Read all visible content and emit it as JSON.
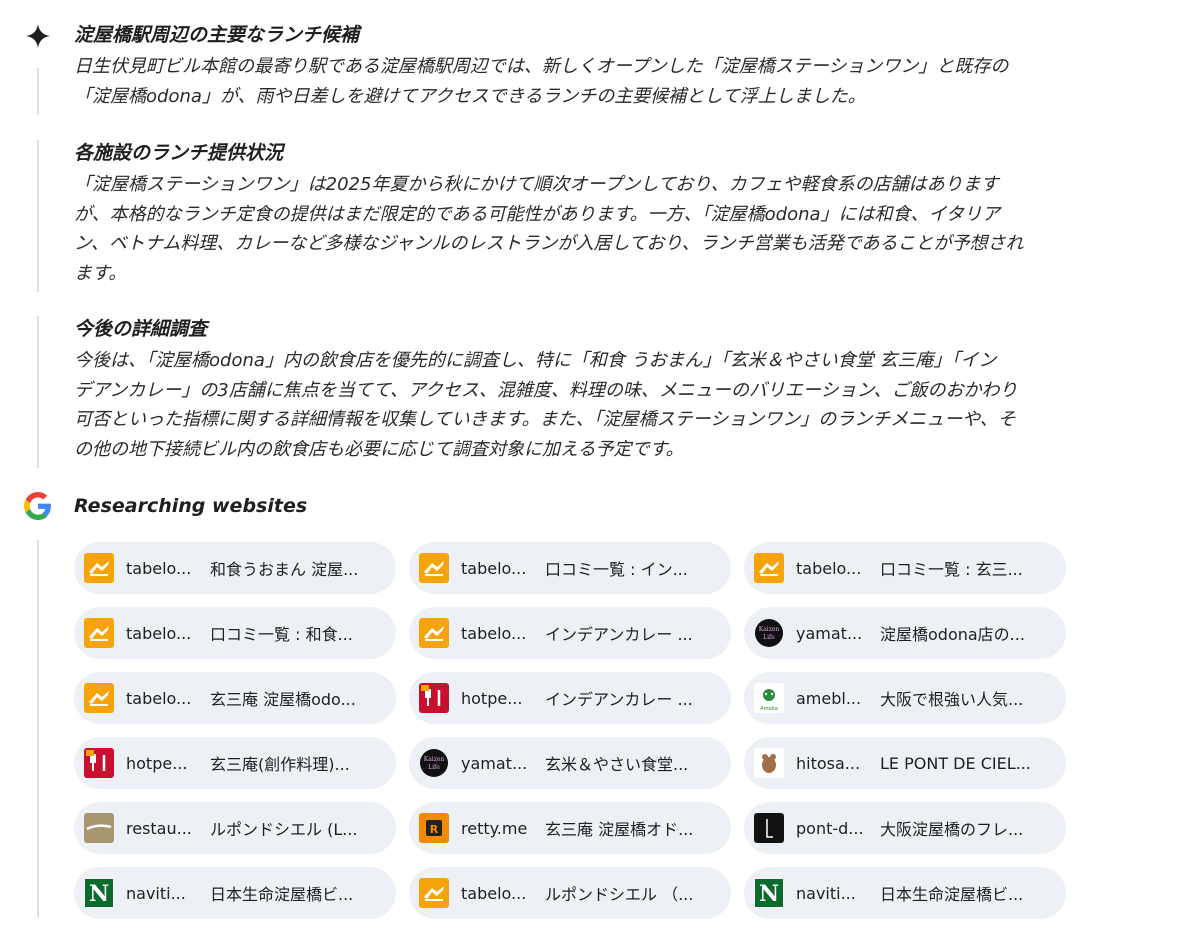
{
  "sections": [
    {
      "heading": "淀屋橋駅周辺の主要なランチ候補",
      "lines": [
        "日生伏見町ビル本館の最寄り駅である淀屋橋駅周辺では、新しくオープンした「淀屋橋ステーションワン」と既存の",
        "「淀屋橋odona」が、雨や日差しを避けてアクセスできるランチの主要候補として浮上しました。"
      ]
    },
    {
      "heading": "各施設のランチ提供状況",
      "lines": [
        "「淀屋橋ステーションワン」は2025年夏から秋にかけて順次オープンしており、カフェや軽食系の店舗はあります",
        "が、本格的なランチ定食の提供はまだ限定的である可能性があります。一方、「淀屋橋odona」には和食、イタリア",
        "ン、ベトナム料理、カレーなど多様なジャンルのレストランが入居しており、ランチ営業も活発であることが予想され",
        "ます。"
      ]
    },
    {
      "heading": "今後の詳細調査",
      "lines": [
        "今後は、「淀屋橋odona」内の飲食店を優先的に調査し、特に「和食 うおまん」「玄米＆やさい食堂 玄三庵」「イン",
        "デアンカレー」の3店舗に焦点を当てて、アクセス、混雑度、料理の味、メニューのバリエーション、ご飯のおかわり",
        "可否といった指標に関する詳細情報を収集していきます。また、「淀屋橋ステーションワン」のランチメニューや、そ",
        "の他の地下接続ビル内の飲食店も必要に応じて調査対象に加える予定です。"
      ]
    }
  ],
  "research": {
    "title": "Researching websites"
  },
  "sources": [
    {
      "icon": "tabelog",
      "domain": "tabelo...",
      "title": "和食うおまん 淀屋..."
    },
    {
      "icon": "tabelog",
      "domain": "tabelo...",
      "title": "口コミ一覧 : イン..."
    },
    {
      "icon": "tabelog",
      "domain": "tabelo...",
      "title": "口コミ一覧 : 玄三..."
    },
    {
      "icon": "tabelog",
      "domain": "tabelo...",
      "title": "口コミ一覧 : 和食..."
    },
    {
      "icon": "tabelog",
      "domain": "tabelo...",
      "title": "インデアンカレー ..."
    },
    {
      "icon": "yamato",
      "domain": "yamat...",
      "title": "淀屋橋odona店の..."
    },
    {
      "icon": "tabelog",
      "domain": "tabelo...",
      "title": "玄三庵 淀屋橋odo..."
    },
    {
      "icon": "hotpepper",
      "domain": "hotpe...",
      "title": "インデアンカレー ..."
    },
    {
      "icon": "ameba",
      "domain": "amebl...",
      "title": "大阪で根強い人気..."
    },
    {
      "icon": "hotpepper",
      "domain": "hotpe...",
      "title": "玄三庵(創作料理)..."
    },
    {
      "icon": "yamato",
      "domain": "yamat...",
      "title": "玄米＆やさい食堂..."
    },
    {
      "icon": "hitosara",
      "domain": "hitosa...",
      "title": "LE PONT DE CIEL..."
    },
    {
      "icon": "restaurant",
      "domain": "restau...",
      "title": "ルポンドシエル (L..."
    },
    {
      "icon": "retty",
      "domain": "retty.me",
      "title": "玄三庵 淀屋橋オド..."
    },
    {
      "icon": "pontdeciel",
      "domain": "pont-d...",
      "title": "大阪淀屋橋のフレ..."
    },
    {
      "icon": "navitime",
      "domain": "naviti...",
      "title": "日本生命淀屋橋ビ..."
    },
    {
      "icon": "tabelog",
      "domain": "tabelo...",
      "title": "ルポンドシエル （..."
    },
    {
      "icon": "navitime",
      "domain": "naviti...",
      "title": "日本生命淀屋橋ビ..."
    }
  ],
  "colors": {
    "chip_bg": "#edf1f6",
    "tabelog": "#f7a30a",
    "hotpepper": "#c8102e",
    "navitime": "#0b6b2d",
    "thread_line": "#dcdfe4"
  }
}
